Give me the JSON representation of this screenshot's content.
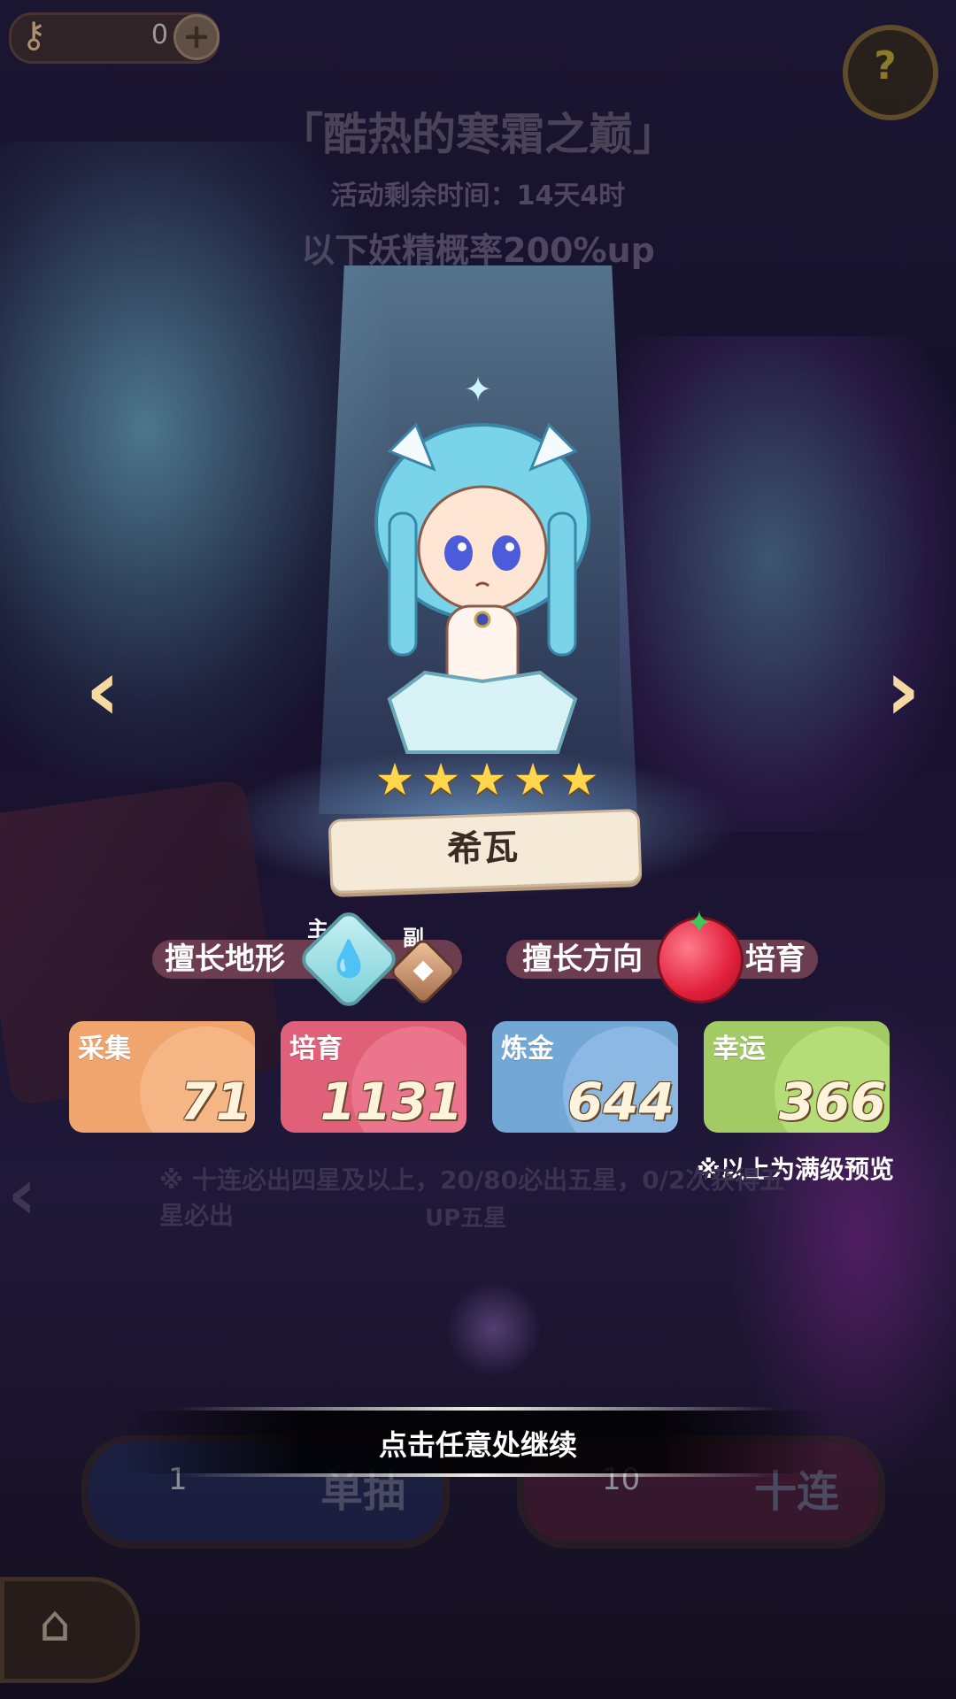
{
  "top_bar": {
    "key_icon": "key-icon",
    "key_count": "0",
    "plus_icon": "plus-icon",
    "help_icon": "question-icon"
  },
  "event": {
    "title": "「酷热的寒霜之巅」",
    "time_remaining": "活动剩余时间：14天4时",
    "rate_up": "以下妖精概率200%up"
  },
  "navigation": {
    "prev_icon": "chevron-left-icon",
    "next_icon": "chevron-right-icon"
  },
  "character": {
    "name": "希瓦",
    "stars": 5,
    "terrain_label": "擅长地形",
    "terrain_main_tag": "主",
    "terrain_sub_tag": "副",
    "terrain_main_icon": "water-drop-icon",
    "terrain_sub_icon": "crystal-icon",
    "direction_label": "擅长方向",
    "direction_icon": "tomato-icon",
    "direction_value": "培育"
  },
  "stats": [
    {
      "label": "采集",
      "value": "71",
      "color": "#f0a46e"
    },
    {
      "label": "培育",
      "value": "1131",
      "color": "#e0607a"
    },
    {
      "label": "炼金",
      "value": "644",
      "color": "#73a7d6"
    },
    {
      "label": "幸运",
      "value": "366",
      "color": "#a3cb65"
    }
  ],
  "preview_note": "※以上为满级预览",
  "background_rules": {
    "line1": "※ 十连必出四星及以上，20/80必出五星，0/2次获得五星必出",
    "line2": "UP五星"
  },
  "continue_prompt": "点击任意处继续",
  "pull_buttons": {
    "single_count": "1",
    "single_label": "单抽",
    "ten_count": "10",
    "ten_label": "十连"
  },
  "home_icon": "home-icon",
  "colors": {
    "background": "#15112a",
    "star": "#ffd64d",
    "banner": "#f5ead8",
    "pill": "#6b3d4e"
  }
}
